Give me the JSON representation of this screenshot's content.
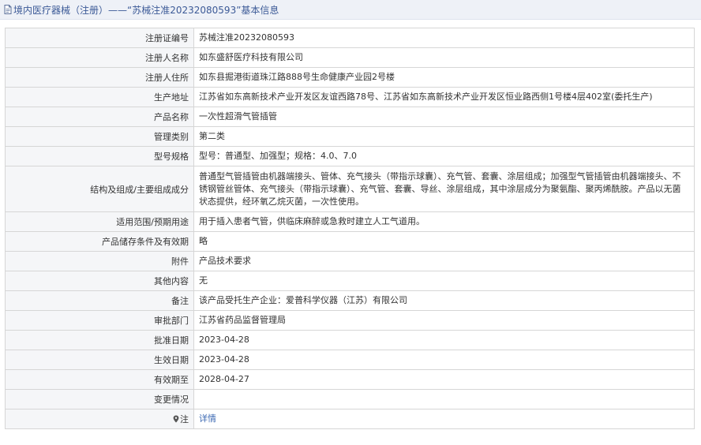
{
  "header": {
    "title": "境内医疗器械（注册）——“苏械注准20232080593”基本信息"
  },
  "rows": [
    {
      "label": "注册证编号",
      "value": "苏械注准20232080593"
    },
    {
      "label": "注册人名称",
      "value": "如东盛舒医疗科技有限公司"
    },
    {
      "label": "注册人住所",
      "value": "如东县掘港街道珠江路888号生命健康产业园2号楼"
    },
    {
      "label": "生产地址",
      "value": "江苏省如东高新技术产业开发区友谊西路78号、江苏省如东高新技术产业开发区恒业路西侧1号楼4层402室(委托生产)"
    },
    {
      "label": "产品名称",
      "value": "一次性超滑气管插管"
    },
    {
      "label": "管理类别",
      "value": "第二类"
    },
    {
      "label": "型号规格",
      "value": "型号：普通型、加强型；规格：4.0、7.0"
    },
    {
      "label": "结构及组成/主要组成成分",
      "value": "普通型气管插管由机器端接头、管体、充气接头（带指示球囊）、充气管、套囊、涂层组成；加强型气管插管由机器端接头、不锈钢管丝管体、充气接头（带指示球囊）、充气管、套囊、导丝、涂层组成，其中涂层成分为聚氨酯、聚丙烯酰胺。产品以无菌状态提供，经环氧乙烷灭菌，一次性使用。"
    },
    {
      "label": "适用范围/预期用途",
      "value": "用于插入患者气管，供临床麻醉或急救时建立人工气道用。"
    },
    {
      "label": "产品储存条件及有效期",
      "value": "略"
    },
    {
      "label": "附件",
      "value": "产品技术要求"
    },
    {
      "label": "其他内容",
      "value": "无"
    },
    {
      "label": "备注",
      "value": "该产品受托生产企业：爱普科学仪器（江苏）有限公司"
    },
    {
      "label": "审批部门",
      "value": "江苏省药品监督管理局"
    },
    {
      "label": "批准日期",
      "value": "2023-04-28"
    },
    {
      "label": "生效日期",
      "value": "2023-04-28"
    },
    {
      "label": "有效期至",
      "value": "2028-04-27"
    },
    {
      "label": "变更情况",
      "value": ""
    },
    {
      "label": "注",
      "value": "详情"
    }
  ],
  "icons": {
    "title": "document-icon",
    "note": "pin-icon"
  },
  "colors": {
    "title_text": "#3c5a97",
    "link": "#3d6ab3",
    "label_bg": "#f5f6f8",
    "border": "#d6d6d6"
  }
}
